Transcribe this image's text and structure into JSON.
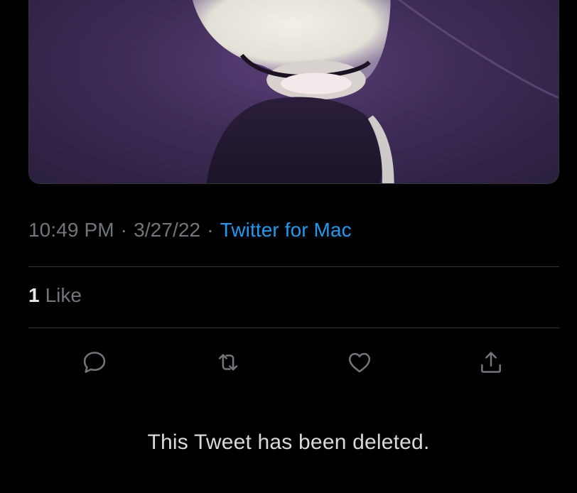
{
  "tweet": {
    "media": {
      "description_icon": "photo-image",
      "palette": [
        "#5a3f78",
        "#3e2c57",
        "#2a1f3d",
        "#e8e6df"
      ]
    },
    "time": "10:49 PM",
    "date": "3/27/22",
    "separator": "·",
    "source": "Twitter for Mac",
    "likes": {
      "count": "1",
      "label": "Like"
    },
    "actions": [
      {
        "name": "reply",
        "icon": "reply-icon"
      },
      {
        "name": "retweet",
        "icon": "retweet-icon"
      },
      {
        "name": "like",
        "icon": "heart-icon"
      },
      {
        "name": "share",
        "icon": "share-icon"
      }
    ]
  },
  "notice": {
    "text": "This Tweet has been deleted."
  },
  "colors": {
    "background": "#000000",
    "muted_text": "#71767b",
    "primary_text": "#e7e9ea",
    "link": "#1d9bf0",
    "divider": "#2f3336"
  }
}
